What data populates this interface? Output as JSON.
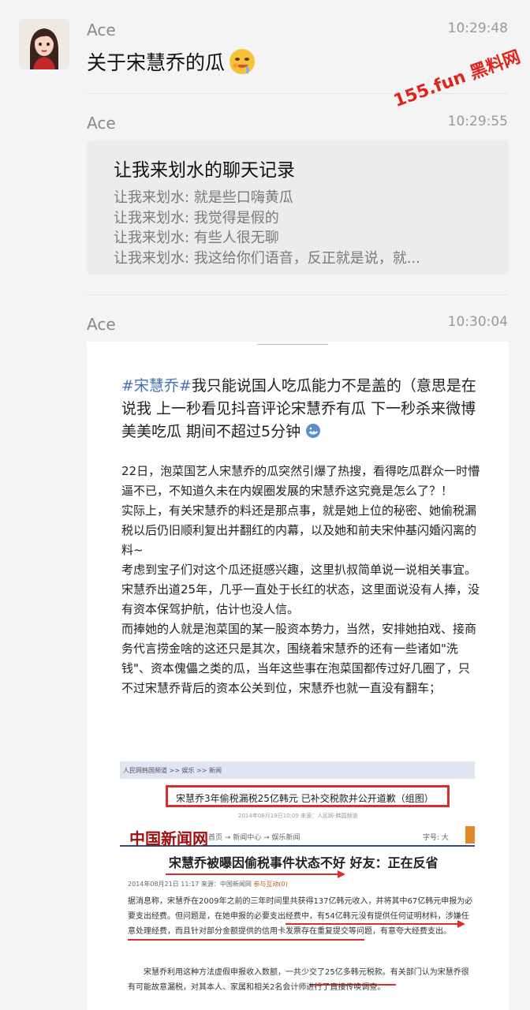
{
  "messages": [
    {
      "sender": "Ace",
      "time": "10:29:48",
      "text": "关于宋慧乔的瓜"
    },
    {
      "sender": "Ace",
      "time": "10:29:55"
    },
    {
      "sender": "Ace",
      "time": "10:30:04"
    }
  ],
  "watermark": "155.fun 黑料网",
  "record": {
    "title": "让我来划水的聊天记录",
    "lines": [
      "让我来划水: 就是些口嗨黄瓜",
      "让我来划水: 我觉得是假的",
      "让我来划水: 有些人很无聊",
      "让我来划水: 我这给你们语音，反正就是说，就..."
    ]
  },
  "post": {
    "hashtag": "#宋慧乔#",
    "headline": "我只能说国人吃瓜能力不是盖的（意思是在说我 上一秒看见抖音评论宋慧乔有瓜 下一秒杀来微博美美吃瓜 期间不超过5分钟",
    "paragraphs": [
      "22日，泡菜国艺人宋慧乔的瓜突然引爆了热搜，看得吃瓜群众一时懵逼不已，不知道久未在内娱圈发展的宋慧乔这究竟是怎么了？！",
      "实际上，有关宋慧乔的料还是那点事，就是她上位的秘密、她偷税漏税以后仍旧顺利复出并翻红的内幕，以及她和前夫宋仲基闪婚闪离的料~",
      "考虑到宝子们对这个瓜还挺感兴趣，这里扒叔简单说一说相关事宜。",
      "宋慧乔出道25年，几乎一直处于长红的状态，这里面说没有人捧，没有资本保驾护航，估计也没人信。",
      "而捧她的人就是泡菜国的某一股资本势力，当然，安排她拍戏、接商务代言捞金啥的这还只是其次，围绕着宋慧乔的还有一些诸如\"洗钱\"、资本傀儡之类的瓜，当年这些事在泡菜国都传过好几圈了，只不过宋慧乔背后的资本公关到位，宋慧乔也就一直没有翻车；"
    ]
  },
  "news": {
    "breadcrumb": "人民网韩国频道  >>  娱乐  >>  新闻",
    "boxed_title": "宋慧乔3年偷税漏税25亿韩元 已补交税款并公开道歉（组图）",
    "date1": "2014年08月19日10:09    来源：人民网-韩国频道",
    "logo": "中国新闻网",
    "crumbs": "首页 → 新闻中心 → 娱乐新闻",
    "zihao": "字号:   大",
    "headline": "宋慧乔被曝因偷税事件状态不好 好友：正在反省",
    "meta_prefix": "2014年08月21日 11:17   来源：中国新闻网",
    "meta_link": "参与互动(0)",
    "para1": "据消息称，宋慧乔在2009年之前的三年时间里共获得137亿韩元收入，并将其中67亿韩元申报为必要支出经费。但问题是，在她申报的必要支出经费中，有54亿韩元没有提供任何证明材料，涉嫌任意处理经费，而且针对部分金额提供的信用卡发票存在重复提交等问题，有意夸大经费支出。",
    "para2": "宋慧乔利用这种方法虚假申报收入数额，一共少交了25亿多韩元税款。有关部门认为宋慧乔很有可能故意漏税，对其本人、家属和相关2名会计师进行了直接传唤调查。"
  }
}
